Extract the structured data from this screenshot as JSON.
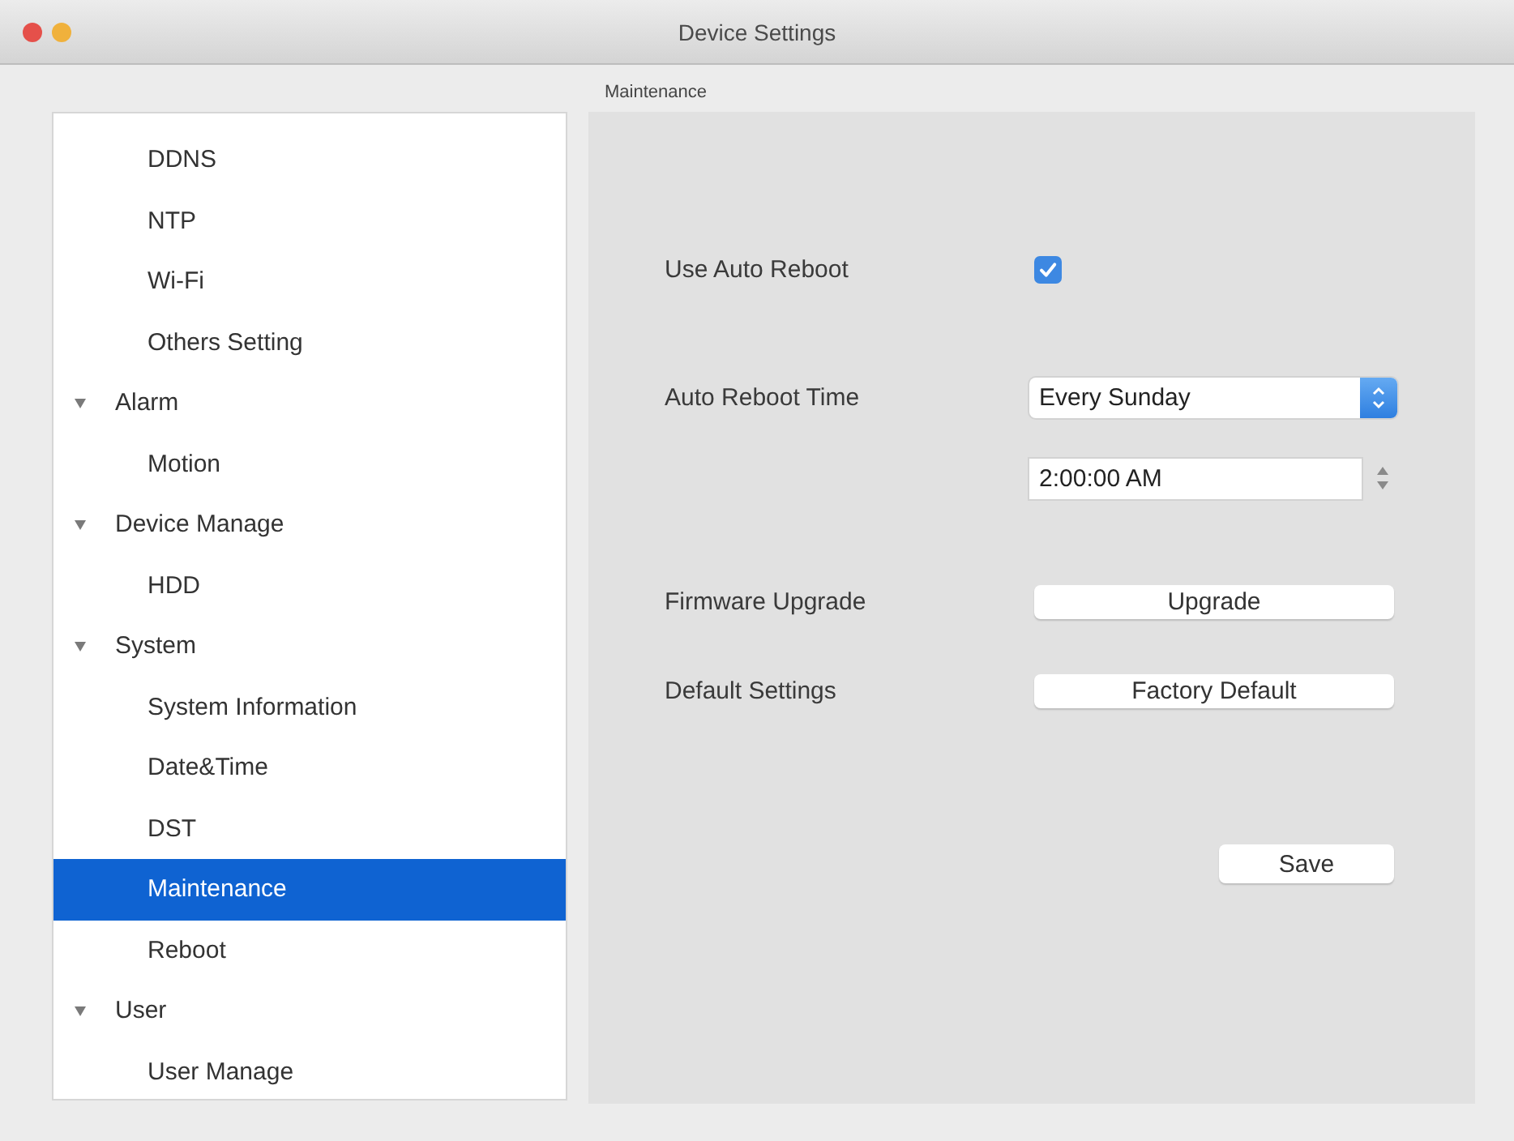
{
  "window": {
    "title": "Device Settings"
  },
  "sidebar": {
    "items": [
      {
        "children": [
          {
            "label": "DDNS",
            "selected": false
          },
          {
            "label": "NTP",
            "selected": false
          },
          {
            "label": "Wi-Fi",
            "selected": false
          },
          {
            "label": "Others Setting",
            "selected": false
          }
        ]
      },
      {
        "label": "Alarm",
        "expanded": true,
        "selected": false,
        "children": [
          {
            "label": "Motion",
            "selected": false
          }
        ]
      },
      {
        "label": "Device Manage",
        "expanded": true,
        "selected": false,
        "children": [
          {
            "label": "HDD",
            "selected": false
          }
        ]
      },
      {
        "label": "System",
        "expanded": true,
        "selected": false,
        "children": [
          {
            "label": "System Information",
            "selected": false
          },
          {
            "label": "Date&Time",
            "selected": false
          },
          {
            "label": "DST",
            "selected": false
          },
          {
            "label": "Maintenance",
            "selected": true
          },
          {
            "label": "Reboot",
            "selected": false
          }
        ]
      },
      {
        "label": "User",
        "expanded": true,
        "selected": false,
        "children": [
          {
            "label": "User Manage",
            "selected": false
          }
        ]
      }
    ]
  },
  "panel": {
    "title": "Maintenance",
    "fields": [
      {
        "kind": "checkbox",
        "label": "Use Auto Reboot",
        "checked": true
      },
      {
        "kind": "dropdown",
        "label": "Auto Reboot Time",
        "value": "Every Sunday"
      },
      {
        "kind": "time",
        "value": "2:00:00 AM"
      },
      {
        "kind": "button",
        "label": "Firmware Upgrade",
        "button": "Upgrade"
      },
      {
        "kind": "button",
        "label": "Default Settings",
        "button": "Factory Default"
      }
    ],
    "save_button": "Save"
  }
}
